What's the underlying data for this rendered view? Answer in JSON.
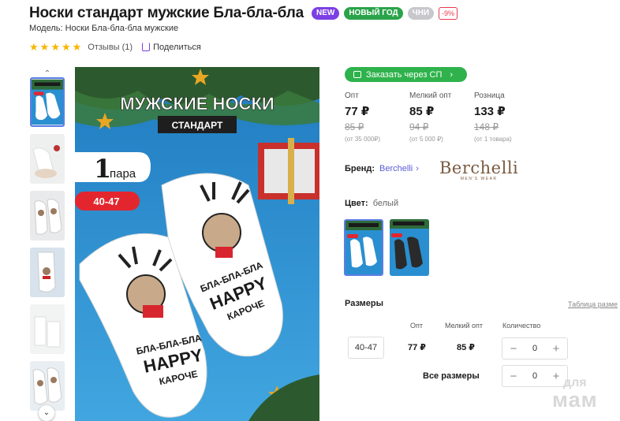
{
  "product": {
    "title": "Носки стандарт мужские Бла-бла-бла",
    "badges": {
      "new": "NEW",
      "new_year": "НОВЫЙ ГОД",
      "chni": "ЧНИ",
      "discount": "-9%"
    },
    "model": "Модель: Носки Бла-бла-бла мужские",
    "rating_stars": 5,
    "reviews_label": "Отзывы (1)",
    "share_label": "Поделиться"
  },
  "image": {
    "headline": "МУЖСКИЕ НОСКИ",
    "subline": "СТАНДАРТ",
    "pair_count": "1",
    "pair_word": "пара",
    "size_tag": "40-47",
    "sock_text_1": "БЛА-БЛА-БЛА",
    "sock_text_2": "HAPPY",
    "sock_text_3": "КАРОЧЕ"
  },
  "order_button": {
    "label": "Заказать через СП",
    "arrow": "›"
  },
  "prices": [
    {
      "label": "Опт",
      "price": "77 ₽",
      "old": "85 ₽",
      "note": "(от 35 000₽)"
    },
    {
      "label": "Мелкий опт",
      "price": "85 ₽",
      "old": "94 ₽",
      "note": "(от 5 000 ₽)"
    },
    {
      "label": "Розница",
      "price": "133 ₽",
      "old": "148 ₽",
      "note": "(от 1 товара)"
    }
  ],
  "brand": {
    "label": "Бренд:",
    "name": "Berchelli",
    "logo_main": "Berchelli",
    "logo_sub": "MEN'S WEAR"
  },
  "color": {
    "label": "Цвет:",
    "value": "белый"
  },
  "sizes": {
    "title": "Размеры",
    "table_link": "Таблица разме",
    "headers": {
      "opt": "Опт",
      "small_opt": "Мелкий опт",
      "qty": "Количество"
    },
    "rows": [
      {
        "size": "40-47",
        "opt": "77 ₽",
        "small_opt": "85 ₽",
        "qty": "0"
      }
    ],
    "all_sizes_label": "Все размеры",
    "all_sizes_qty": "0"
  },
  "watermark": {
    "line1": "для",
    "line2": "мам"
  },
  "colors": {
    "accent": "#7b3fe4",
    "green": "#2fb24c",
    "link": "#5b5ad6",
    "discount": "#e8384f"
  }
}
